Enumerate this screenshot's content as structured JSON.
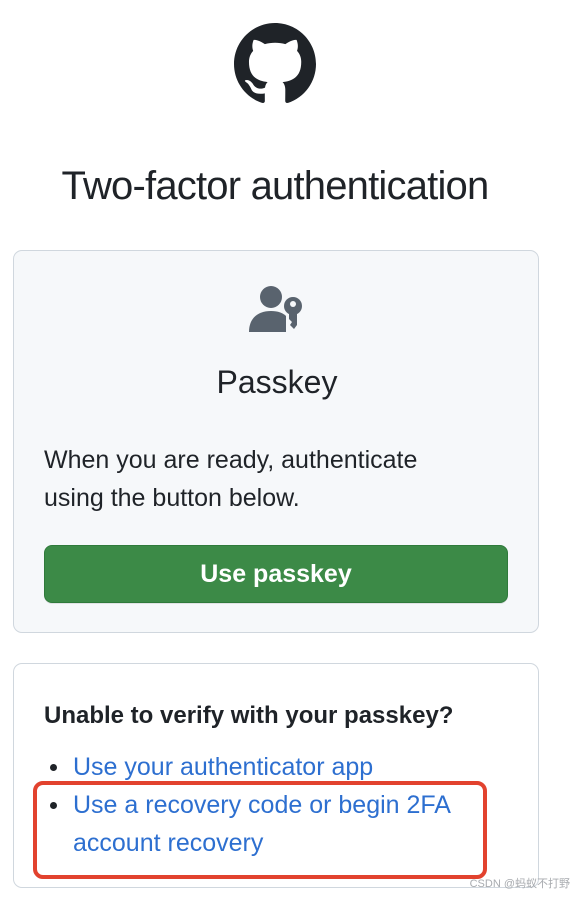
{
  "page": {
    "title": "Two-factor authentication"
  },
  "passkey_card": {
    "title": "Passkey",
    "description": "When you are ready, authenticate using the button below.",
    "button_label": "Use passkey",
    "icon": "person-key-icon"
  },
  "alternatives": {
    "heading": "Unable to verify with your passkey?",
    "options": [
      {
        "label": "Use your authenticator app"
      },
      {
        "label": "Use a recovery code or begin 2FA account recovery"
      }
    ]
  },
  "watermark": "CSDN @蚂蚁不打野",
  "colors": {
    "primary_button": "#3c8a47",
    "link": "#2d6fd0",
    "highlight_border": "#e2422e",
    "card_background": "#f6f8fa",
    "card_border": "#d0d7de"
  }
}
